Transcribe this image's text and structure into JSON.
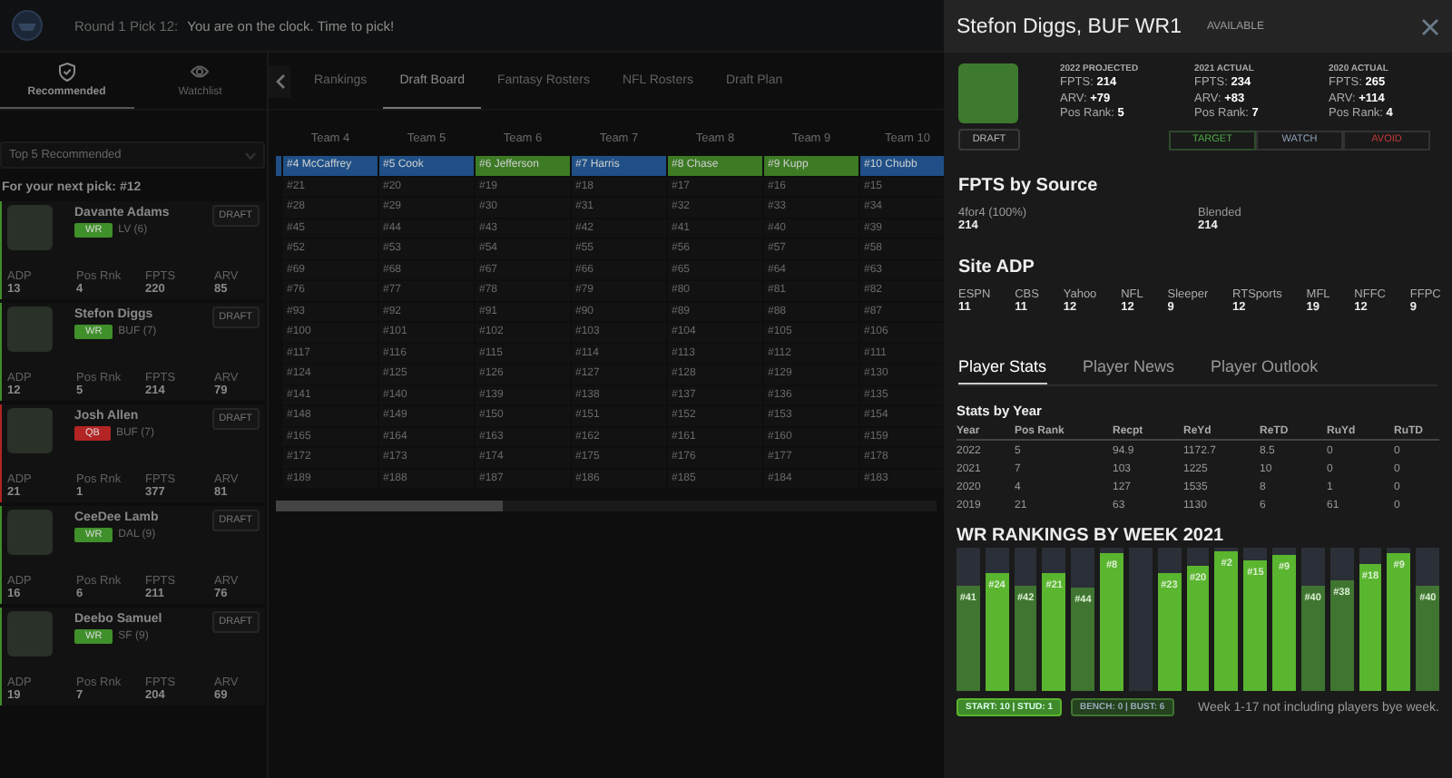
{
  "top_bar": {
    "pick": "Round 1 Pick 12:",
    "message": "You are on the clock. Time to pick!"
  },
  "sidebar": {
    "tabs": [
      {
        "label": "Recommended",
        "kind": "shield",
        "selected": true
      },
      {
        "label": "Watchlist",
        "kind": "eye",
        "selected": false
      }
    ],
    "dropdown": {
      "value": "Top 5 Recommended"
    },
    "heading": "For your next pick: #12",
    "players": [
      {
        "name": "Davante Adams",
        "position": "WR",
        "color": "#3f8f2a",
        "team": "LV (6)",
        "draft": "DRAFT",
        "stats": [
          {
            "label": "ADP",
            "value": "13"
          },
          {
            "label": "Pos Rnk",
            "value": "4"
          },
          {
            "label": "FPTS",
            "value": "220"
          },
          {
            "label": "ARV",
            "value": "85"
          }
        ]
      },
      {
        "name": "Stefon Diggs",
        "position": "WR",
        "color": "#3f8f2a",
        "team": "BUF (7)",
        "draft": "DRAFT",
        "stats": [
          {
            "label": "ADP",
            "value": "12"
          },
          {
            "label": "Pos Rnk",
            "value": "5"
          },
          {
            "label": "FPTS",
            "value": "214"
          },
          {
            "label": "ARV",
            "value": "79"
          }
        ]
      },
      {
        "name": "Josh Allen",
        "position": "QB",
        "color": "#b32424",
        "team": "BUF (7)",
        "draft": "DRAFT",
        "stats": [
          {
            "label": "ADP",
            "value": "21"
          },
          {
            "label": "Pos Rnk",
            "value": "1"
          },
          {
            "label": "FPTS",
            "value": "377"
          },
          {
            "label": "ARV",
            "value": "81"
          }
        ]
      },
      {
        "name": "CeeDee Lamb",
        "position": "WR",
        "color": "#3f8f2a",
        "team": "DAL (9)",
        "draft": "DRAFT",
        "stats": [
          {
            "label": "ADP",
            "value": "16"
          },
          {
            "label": "Pos Rnk",
            "value": "6"
          },
          {
            "label": "FPTS",
            "value": "211"
          },
          {
            "label": "ARV",
            "value": "76"
          }
        ]
      },
      {
        "name": "Deebo Samuel",
        "position": "WR",
        "color": "#3f8f2a",
        "team": "SF (9)",
        "draft": "DRAFT",
        "stats": [
          {
            "label": "ADP",
            "value": "19"
          },
          {
            "label": "Pos Rnk",
            "value": "7"
          },
          {
            "label": "FPTS",
            "value": "204"
          },
          {
            "label": "ARV",
            "value": "69"
          }
        ]
      }
    ]
  },
  "main": {
    "tabs": [
      {
        "label": "Rankings",
        "selected": false
      },
      {
        "label": "Draft Board",
        "selected": true
      },
      {
        "label": "Fantasy Rosters",
        "selected": false
      },
      {
        "label": "NFL Rosters",
        "selected": false
      },
      {
        "label": "Draft Plan",
        "selected": false
      }
    ],
    "board": {
      "columns": [
        "Team 4",
        "Team 5",
        "Team 6",
        "Team 7",
        "Team 8",
        "Team 9",
        "Team 10"
      ],
      "picks": [
        {
          "text": "#4 McCaffrey",
          "color": "#1f4f86"
        },
        {
          "text": "#5 Cook",
          "color": "#1f4f86"
        },
        {
          "text": "#6 Jefferson",
          "color": "#3c7a24"
        },
        {
          "text": "#7 Harris",
          "color": "#1f4f86"
        },
        {
          "text": "#8 Chase",
          "color": "#3c7a24"
        },
        {
          "text": "#9 Kupp",
          "color": "#3c7a24"
        },
        {
          "text": "#10 Chubb",
          "color": "#1f4f86"
        }
      ],
      "rows": [
        [
          "#21",
          "#20",
          "#19",
          "#18",
          "#17",
          "#16",
          "#15"
        ],
        [
          "#28",
          "#29",
          "#30",
          "#31",
          "#32",
          "#33",
          "#34"
        ],
        [
          "#45",
          "#44",
          "#43",
          "#42",
          "#41",
          "#40",
          "#39"
        ],
        [
          "#52",
          "#53",
          "#54",
          "#55",
          "#56",
          "#57",
          "#58"
        ],
        [
          "#69",
          "#68",
          "#67",
          "#66",
          "#65",
          "#64",
          "#63"
        ],
        [
          "#76",
          "#77",
          "#78",
          "#79",
          "#80",
          "#81",
          "#82"
        ],
        [
          "#93",
          "#92",
          "#91",
          "#90",
          "#89",
          "#88",
          "#87"
        ],
        [
          "#100",
          "#101",
          "#102",
          "#103",
          "#104",
          "#105",
          "#106"
        ],
        [
          "#117",
          "#116",
          "#115",
          "#114",
          "#113",
          "#112",
          "#111"
        ],
        [
          "#124",
          "#125",
          "#126",
          "#127",
          "#128",
          "#129",
          "#130"
        ],
        [
          "#141",
          "#140",
          "#139",
          "#138",
          "#137",
          "#136",
          "#135"
        ],
        [
          "#148",
          "#149",
          "#150",
          "#151",
          "#152",
          "#153",
          "#154"
        ],
        [
          "#165",
          "#164",
          "#163",
          "#162",
          "#161",
          "#160",
          "#159"
        ],
        [
          "#172",
          "#173",
          "#174",
          "#175",
          "#176",
          "#177",
          "#178"
        ],
        [
          "#189",
          "#188",
          "#187",
          "#186",
          "#185",
          "#184",
          "#183"
        ]
      ]
    }
  },
  "panel": {
    "title": "Stefon Diggs, BUF WR1",
    "status": "AVAILABLE",
    "stat_columns": [
      {
        "title": "2022 PROJECTED",
        "lines": [
          "FPTS: **214**",
          "ARV: **+79**",
          "Pos Rank: **5**"
        ]
      },
      {
        "title": "2021 ACTUAL",
        "lines": [
          "FPTS: **234**",
          "ARV: **+83**",
          "Pos Rank: **7**"
        ]
      },
      {
        "title": "2020 ACTUAL",
        "lines": [
          "FPTS: **265**",
          "ARV: **+114**",
          "Pos Rank: **4**"
        ]
      }
    ],
    "draft": "DRAFT",
    "actions": [
      {
        "label": "TARGET",
        "kind": "target"
      },
      {
        "label": "WATCH",
        "kind": "watch"
      },
      {
        "label": "AVOID",
        "kind": "avoid"
      }
    ],
    "fpts_by_source": {
      "title": "FPTS by Source",
      "items": [
        {
          "label": "4for4 (100%)",
          "value": "214"
        },
        {
          "label": "Blended",
          "value": "214"
        }
      ]
    },
    "site_adp": {
      "title": "Site ADP",
      "items": [
        {
          "label": "ESPN",
          "value": "11"
        },
        {
          "label": "CBS",
          "value": "11"
        },
        {
          "label": "Yahoo",
          "value": "12"
        },
        {
          "label": "NFL",
          "value": "12"
        },
        {
          "label": "Sleeper",
          "value": "9"
        },
        {
          "label": "RTSports",
          "value": "12"
        },
        {
          "label": "MFL",
          "value": "19"
        },
        {
          "label": "NFFC",
          "value": "12"
        },
        {
          "label": "FFPC",
          "value": "9"
        }
      ]
    },
    "tabs": [
      {
        "label": "Player Stats",
        "selected": true
      },
      {
        "label": "Player News",
        "selected": false
      },
      {
        "label": "Player Outlook",
        "selected": false
      }
    ],
    "stats_by_year": {
      "title": "Stats by Year",
      "columns": [
        "Year",
        "Pos Rank",
        "Recpt",
        "ReYd",
        "ReTD",
        "RuYd",
        "RuTD"
      ],
      "rows": [
        [
          "2022",
          "5",
          "94.9",
          "1172.7",
          "8.5",
          "0",
          "0"
        ],
        [
          "2021",
          "7",
          "103",
          "1225",
          "10",
          "0",
          "0"
        ],
        [
          "2020",
          "4",
          "127",
          "1535",
          "8",
          "1",
          "0"
        ],
        [
          "2019",
          "21",
          "63",
          "1130",
          "6",
          "61",
          "0"
        ]
      ]
    },
    "weekly_rankings": {
      "title": "WR RANKINGS BY WEEK 2021",
      "weeks": [
        {
          "label": "#41",
          "level": 0.74,
          "kind": "bust"
        },
        {
          "label": "#24",
          "level": 0.82,
          "kind": "start"
        },
        {
          "label": "#42",
          "level": 0.74,
          "kind": "bust"
        },
        {
          "label": "#21",
          "level": 0.82,
          "kind": "start"
        },
        {
          "label": "#44",
          "level": 0.72,
          "kind": "bust"
        },
        {
          "label": "#8",
          "level": 0.96,
          "kind": "start"
        },
        {
          "kind": "bye"
        },
        {
          "label": "#23",
          "level": 0.82,
          "kind": "start"
        },
        {
          "label": "#20",
          "level": 0.87,
          "kind": "start"
        },
        {
          "label": "#2",
          "level": 0.97,
          "kind": "start"
        },
        {
          "label": "#15",
          "level": 0.91,
          "kind": "start"
        },
        {
          "label": "#9",
          "level": 0.95,
          "kind": "start"
        },
        {
          "label": "#40",
          "level": 0.74,
          "kind": "bust"
        },
        {
          "label": "#38",
          "level": 0.77,
          "kind": "bust"
        },
        {
          "label": "#18",
          "level": 0.89,
          "kind": "start"
        },
        {
          "label": "#9",
          "level": 0.96,
          "kind": "start"
        },
        {
          "label": "#40",
          "level": 0.74,
          "kind": "bust"
        }
      ],
      "legend": [
        {
          "text": "START: 10 | STUD: 1",
          "kind": "start"
        },
        {
          "text": "BENCH: 0 | BUST: 6",
          "kind": "bust"
        }
      ],
      "note": "Week 1-17 not including players bye week."
    }
  }
}
